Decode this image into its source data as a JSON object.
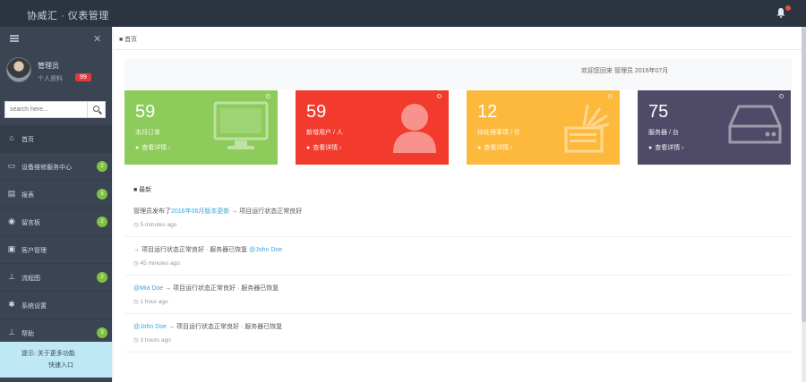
{
  "app": {
    "title": "协威汇 · 仪表管理"
  },
  "sidebar": {
    "user": {
      "name": "管理员",
      "status": "个人资料",
      "badge": "99"
    },
    "search": {
      "placeholder": "search here..."
    },
    "items": [
      {
        "label": "首页",
        "icon": "home-icon",
        "badge": ""
      },
      {
        "label": "设备维修服务中心",
        "icon": "monitor-icon",
        "badge": "2"
      },
      {
        "label": "报表",
        "icon": "document-icon",
        "badge": "5"
      },
      {
        "label": "留言板",
        "icon": "eye-icon",
        "badge": "2"
      },
      {
        "label": "客户管理",
        "icon": "card-icon",
        "badge": ""
      },
      {
        "label": "流程图",
        "icon": "sitemap-icon",
        "badge": "2"
      },
      {
        "label": "系统设置",
        "icon": "gear-icon",
        "badge": ""
      },
      {
        "label": "帮助",
        "icon": "sitemap-icon",
        "badge": "3"
      }
    ],
    "promo": {
      "line1": "提示: 关于更多功能",
      "line2": "快速入口"
    }
  },
  "header": {
    "notifications_badge": ""
  },
  "breadcrumb": "■ 首页",
  "welcome_text": "欢迎您回来 管理员 2016年07月",
  "stats": [
    {
      "number": "59",
      "label": "本月订单",
      "link": "查看详情 ›",
      "color": "#8dcb5a",
      "icon": "monitor-icon"
    },
    {
      "number": "59",
      "label": "新增用户 / 人",
      "link": "查看详情 ›",
      "color": "#f23b2d",
      "icon": "user-icon"
    },
    {
      "number": "12",
      "label": "待处理事项 / 件",
      "link": "查看详情 ›",
      "color": "#fdb93c",
      "icon": "signal-icon"
    },
    {
      "number": "75",
      "label": "服务器 / 台",
      "link": "查看详情 ›",
      "color": "#4f4a67",
      "icon": "hdd-icon"
    }
  ],
  "activity": {
    "title": "■ 最新",
    "items": [
      {
        "prefix": "管理员发布了",
        "link": "2016年06月版本更新",
        "suffix": " → 项目运行状态正常良好",
        "time": "5 minutes ago"
      },
      {
        "prefix": "→ 项目运行状态正常良好 · 服务器已恢复",
        "link": "@John Doe",
        "suffix": "",
        "time": "45 minutes ago"
      },
      {
        "prefix": "",
        "link": "@Mia Doe",
        "suffix": " → 项目运行状态正常良好 · 服务器已恢复",
        "time": "1 hour ago"
      },
      {
        "prefix": "",
        "link": "@John Doe",
        "suffix": " → 项目运行状态正常良好 · 服务器已恢复",
        "time": "3 hours ago"
      }
    ]
  }
}
